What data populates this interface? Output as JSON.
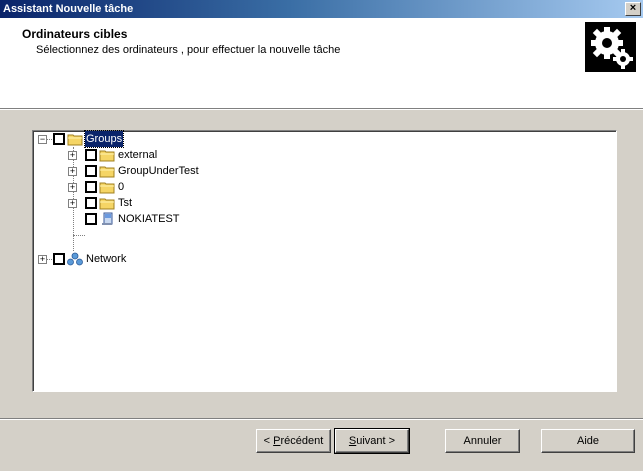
{
  "window": {
    "title": "Assistant Nouvelle tâche",
    "close_label": "×"
  },
  "header": {
    "title": "Ordinateurs cibles",
    "subtitle": "Sélectionnez des ordinateurs , pour effectuer la nouvelle tâche",
    "icon": "gears-icon"
  },
  "tree": {
    "root": {
      "label": "Groups",
      "icon": "folder-icon",
      "expander": "−",
      "checked": false,
      "selected": true
    },
    "children": [
      {
        "label": "external",
        "icon": "folder-icon",
        "expander": "+",
        "checked": false
      },
      {
        "label": "GroupUnderTest",
        "icon": "folder-icon",
        "expander": "+",
        "checked": false
      },
      {
        "label": "0",
        "icon": "folder-icon",
        "expander": "+",
        "checked": false
      },
      {
        "label": "Tst",
        "icon": "folder-icon",
        "expander": "+",
        "checked": false
      },
      {
        "label": "NOKIATEST",
        "icon": "computer-icon",
        "expander": "",
        "checked": false
      }
    ],
    "network": {
      "label": "Network",
      "icon": "network-icon",
      "expander": "+",
      "checked": false
    }
  },
  "buttons": {
    "back": {
      "prefix": "< ",
      "accel": "P",
      "rest": "récédent"
    },
    "next": {
      "accel": "S",
      "rest": "uivant >"
    },
    "cancel": "Annuler",
    "help": "Aide"
  }
}
